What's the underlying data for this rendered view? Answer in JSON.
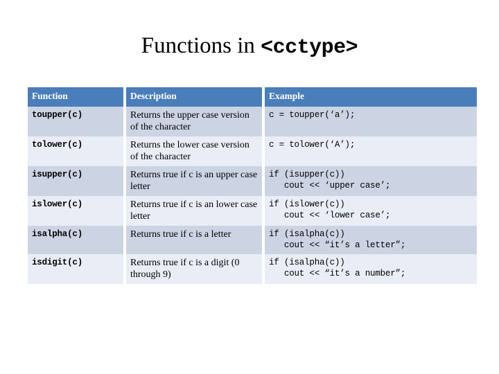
{
  "slide": {
    "title_plain": "Functions in ",
    "title_code": "<cctype>"
  },
  "table": {
    "headers": {
      "function": "Function",
      "description": "Description",
      "example": "Example"
    },
    "header_bg": "#4a7ebb",
    "header_text_color": "#ffffff",
    "band_dark": "#ccd3e3",
    "band_light": "#e9edf5",
    "rows": [
      {
        "function": "toupper(c)",
        "description": "Returns the upper case version of the character",
        "example": "c = toupper(‘a’);"
      },
      {
        "function": "tolower(c)",
        "description": "Returns the lower case version of the character",
        "example": "c = tolower(‘A’);"
      },
      {
        "function": "isupper(c)",
        "description": "Returns true if c is an upper case letter",
        "example": "if (isupper(c))\n   cout << ‘upper case’;"
      },
      {
        "function": "islower(c)",
        "description": "Returns true if c is an lower case letter",
        "example": "if (islower(c))\n   cout << ‘lower case’;"
      },
      {
        "function": "isalpha(c)",
        "description": "Returns true if c is a letter",
        "example": "if (isalpha(c))\n   cout << “it’s a letter”;"
      },
      {
        "function": "isdigit(c)",
        "description": "Returns true if c is a digit (0 through 9)",
        "example": "if (isalpha(c))\n   cout << “it’s a number”;"
      }
    ]
  }
}
